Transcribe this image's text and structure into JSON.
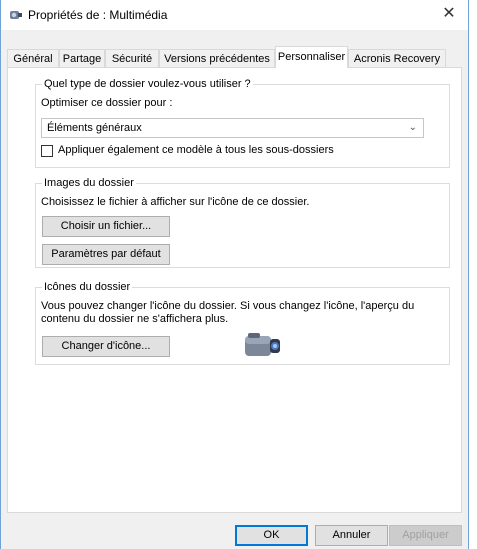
{
  "window": {
    "title": "Propriétés de : Multimédia",
    "close_symbol": "✕"
  },
  "tabs": [
    {
      "label": "Général"
    },
    {
      "label": "Partage"
    },
    {
      "label": "Sécurité"
    },
    {
      "label": "Versions précédentes"
    },
    {
      "label": "Personnaliser",
      "active": true
    },
    {
      "label": "Acronis Recovery"
    }
  ],
  "folder_type": {
    "legend": "Quel type de dossier voulez-vous utiliser ?",
    "optimize_label": "Optimiser ce dossier pour :",
    "selected_value": "Éléments généraux",
    "apply_subfolders_label": "Appliquer également ce modèle à tous les sous-dossiers",
    "apply_subfolders_checked": false
  },
  "folder_pictures": {
    "legend": "Images du dossier",
    "description": "Choisissez le fichier à afficher sur l'icône de ce dossier.",
    "choose_file_button": "Choisir un fichier...",
    "restore_default_button": "Paramètres par défaut"
  },
  "folder_icons": {
    "legend": "Icônes du dossier",
    "description_line1": "Vous pouvez changer l'icône du dossier. Si vous changez l'icône, l'aperçu du",
    "description_line2": "contenu du dossier ne s'affichera plus.",
    "change_icon_button": "Changer d'icône...",
    "preview_icon": "camcorder-icon"
  },
  "footer": {
    "ok_button": "OK",
    "cancel_button": "Annuler",
    "apply_button": "Appliquer"
  }
}
